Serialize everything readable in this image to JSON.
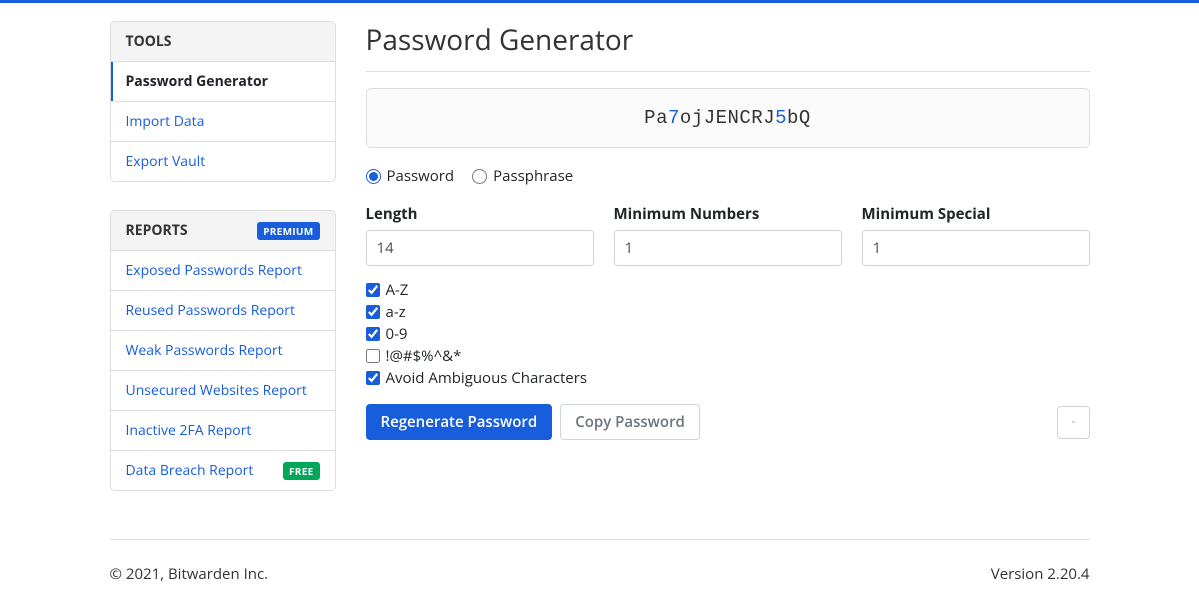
{
  "sidebar": {
    "tools": {
      "header": "TOOLS",
      "items": [
        {
          "label": "Password Generator",
          "active": true
        },
        {
          "label": "Import Data",
          "active": false
        },
        {
          "label": "Export Vault",
          "active": false
        }
      ]
    },
    "reports": {
      "header": "REPORTS",
      "header_badge": "PREMIUM",
      "items": [
        {
          "label": "Exposed Passwords Report"
        },
        {
          "label": "Reused Passwords Report"
        },
        {
          "label": "Weak Passwords Report"
        },
        {
          "label": "Unsecured Websites Report"
        },
        {
          "label": "Inactive 2FA Report"
        },
        {
          "label": "Data Breach Report",
          "badge": "FREE"
        }
      ]
    }
  },
  "page": {
    "title": "Password Generator",
    "generated": {
      "prefix": "Pa",
      "n1": "7",
      "mid": "ojJENCRJ",
      "n2": "5",
      "suffix": "bQ"
    },
    "type_options": {
      "password": "Password",
      "passphrase": "Passphrase",
      "selected": "password"
    },
    "fields": {
      "length": {
        "label": "Length",
        "value": "14"
      },
      "min_numbers": {
        "label": "Minimum Numbers",
        "value": "1"
      },
      "min_special": {
        "label": "Minimum Special",
        "value": "1"
      }
    },
    "checkboxes": {
      "uppercase": {
        "label": "A-Z",
        "checked": true
      },
      "lowercase": {
        "label": "a-z",
        "checked": true
      },
      "numbers": {
        "label": "0-9",
        "checked": true
      },
      "special": {
        "label": "!@#$%^&*",
        "checked": false
      },
      "ambiguous": {
        "label": "Avoid Ambiguous Characters",
        "checked": true
      }
    },
    "buttons": {
      "regenerate": "Regenerate Password",
      "copy": "Copy Password",
      "history_icon": "history-icon"
    }
  },
  "footer": {
    "copyright": "© 2021, Bitwarden Inc.",
    "version": "Version 2.20.4"
  }
}
